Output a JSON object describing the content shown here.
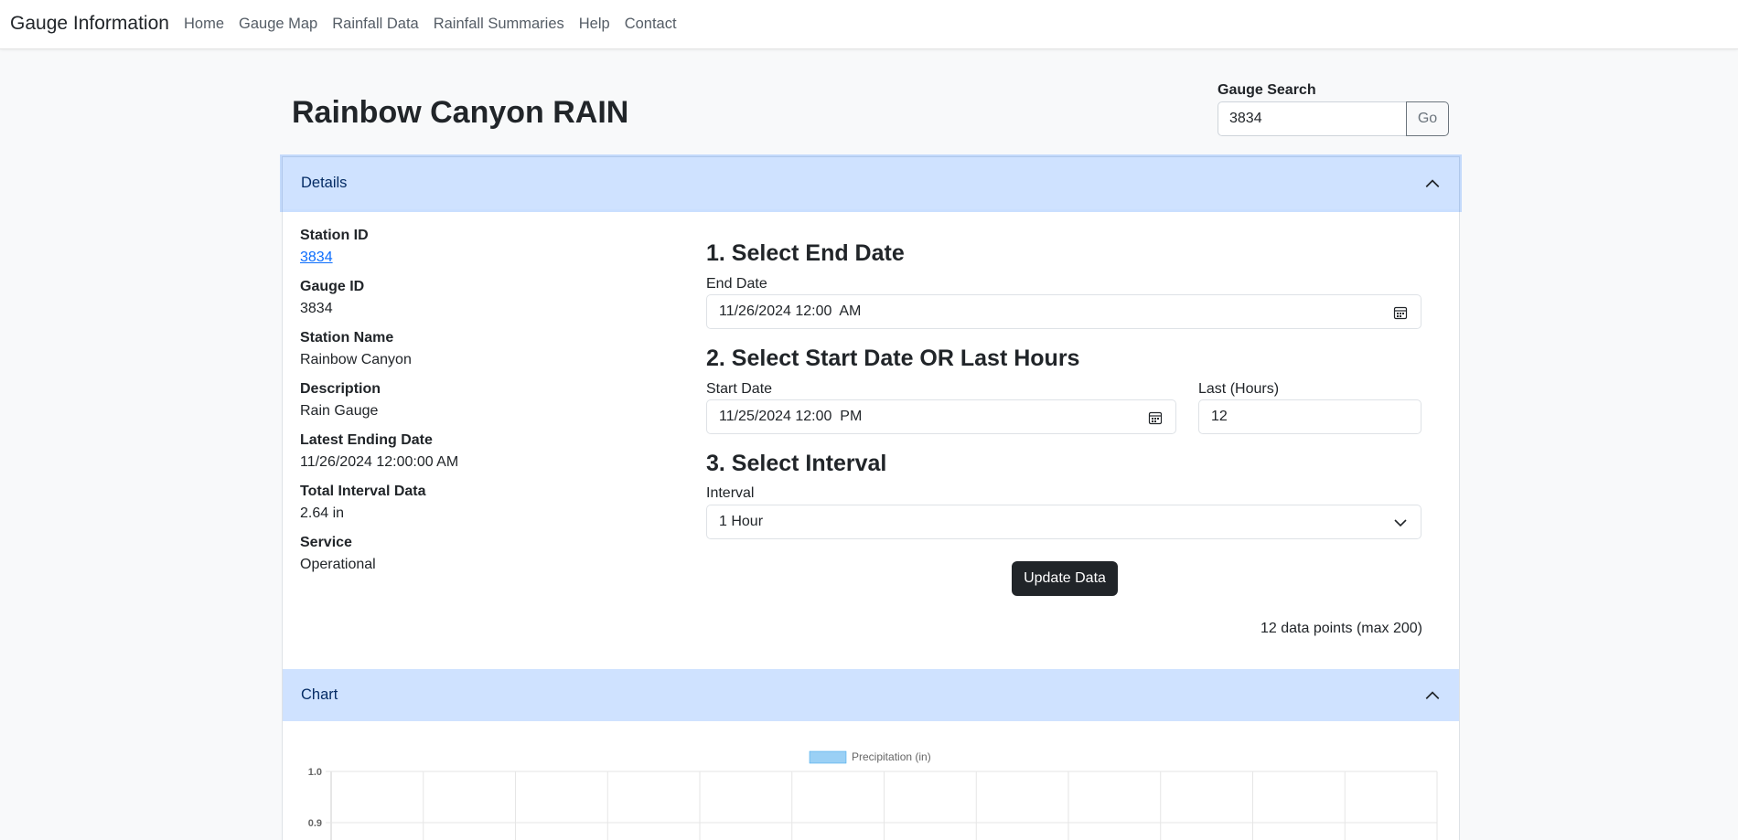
{
  "navbar": {
    "brand": "Gauge Information",
    "links": [
      "Home",
      "Gauge Map",
      "Rainfall Data",
      "Rainfall Summaries",
      "Help",
      "Contact"
    ]
  },
  "page": {
    "title": "Rainbow Canyon RAIN"
  },
  "search": {
    "label": "Gauge Search",
    "value": "3834",
    "button": "Go"
  },
  "details": {
    "header": "Details",
    "fields": [
      {
        "label": "Station ID",
        "value": "3834"
      },
      {
        "label": "Gauge ID",
        "value": "3834"
      },
      {
        "label": "Station Name",
        "value": "Rainbow Canyon"
      },
      {
        "label": "Description",
        "value": "Rain Gauge"
      },
      {
        "label": "Latest Ending Date",
        "value": "11/26/2024 12:00:00 AM"
      },
      {
        "label": "Total Interval Data",
        "value": "2.64 in"
      },
      {
        "label": "Service",
        "value": "Operational"
      }
    ]
  },
  "form": {
    "step1": "1. Select End Date",
    "end_date_label": "End Date",
    "end_date_value": "11/26/2024 12:00  AM",
    "step2": "2. Select Start Date OR Last Hours",
    "start_date_label": "Start Date",
    "start_date_value": "11/25/2024 12:00  PM",
    "last_hours_label": "Last (Hours)",
    "last_hours_value": "12",
    "step3": "3. Select Interval",
    "interval_label": "Interval",
    "interval_value": "1 Hour",
    "update_button": "Update Data",
    "points_text": "12 data points (max 200)"
  },
  "chart_section": {
    "header": "Chart"
  },
  "colors": {
    "accent_header": "#cfe2ff",
    "bar": "#9ad0f5",
    "button_dark": "#212529"
  },
  "chart_data": {
    "type": "bar",
    "series": [
      {
        "name": "Precipitation (in)",
        "values": []
      }
    ],
    "y_ticks": [
      "1.0",
      "0.9"
    ],
    "ylim": [
      0,
      1.0
    ],
    "legend": "top-center",
    "grid": true
  }
}
